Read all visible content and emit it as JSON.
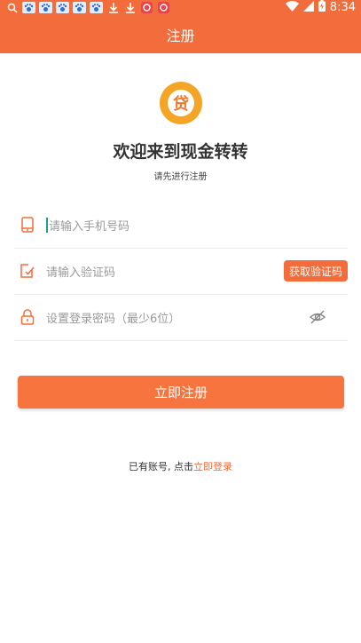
{
  "status_bar": {
    "time": "8:34",
    "left_icons": [
      "search-icon",
      "baidu-paw-icon",
      "baidu-paw-icon",
      "baidu-paw-icon",
      "baidu-paw-icon",
      "baidu-paw-icon",
      "download-icon",
      "download-icon",
      "red-app-icon",
      "red-app-icon"
    ],
    "right_icons": [
      "wifi-icon",
      "signal-icon",
      "battery-icon"
    ]
  },
  "header": {
    "title": "注册"
  },
  "logo": {
    "glyph": "贷"
  },
  "welcome": {
    "title": "欢迎来到现金转转",
    "subtitle": "请先进行注册"
  },
  "form": {
    "phone": {
      "placeholder": "请输入手机号码"
    },
    "code": {
      "placeholder": "请输入验证码",
      "button": "获取验证码"
    },
    "password": {
      "placeholder": "设置登录密码（最少6位）"
    }
  },
  "register_button": "立即注册",
  "footer": {
    "prefix": "已有账号, 点击",
    "link": "立即登录"
  },
  "colors": {
    "accent": "#f36d3c",
    "logo": "#f5a526"
  }
}
